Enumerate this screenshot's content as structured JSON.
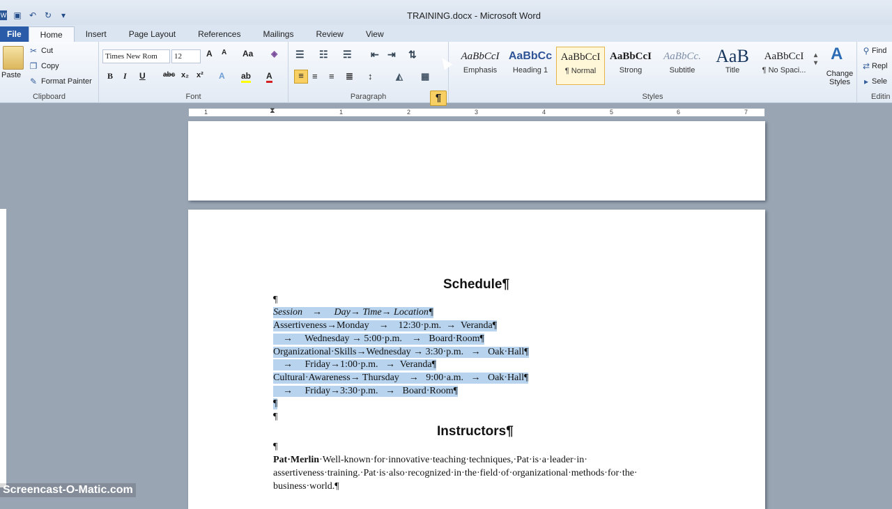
{
  "window": {
    "title": "TRAINING.docx - Microsoft Word",
    "app_icon": "word-icon"
  },
  "tabs": [
    "File",
    "Home",
    "Insert",
    "Page Layout",
    "References",
    "Mailings",
    "Review",
    "View"
  ],
  "clipboard": {
    "group": "Clipboard",
    "paste": "Paste",
    "cut": "Cut",
    "copy": "Copy",
    "painter": "Format Painter"
  },
  "font": {
    "group": "Font",
    "name": "Times New Rom",
    "size": "12"
  },
  "paragraph": {
    "group": "Paragraph",
    "show_marks": "¶"
  },
  "styles": {
    "group": "Styles",
    "items": [
      {
        "preview": "AaBbCcI",
        "name": "Emphasis"
      },
      {
        "preview": "AaBbCc",
        "name": "Heading 1"
      },
      {
        "preview": "AaBbCcI",
        "name": "¶ Normal"
      },
      {
        "preview": "AaBbCcI",
        "name": "Strong"
      },
      {
        "preview": "AaBbCc.",
        "name": "Subtitle"
      },
      {
        "preview": "AaB",
        "name": "Title"
      },
      {
        "preview": "AaBbCcI",
        "name": "¶ No Spaci..."
      }
    ],
    "change": "Change Styles"
  },
  "editing": {
    "group": "Editin",
    "find": "Find",
    "replace": "Repl",
    "select": "Sele"
  },
  "ruler": {
    "marks": [
      "1",
      "1",
      "2",
      "3",
      "4",
      "5",
      "6",
      "7"
    ]
  },
  "document": {
    "heading1": "Schedule¶",
    "blank1": "¶",
    "lines": [
      "Session    →     Day→ Time→ Location¶",
      "Assertiveness→Monday    →    12:30·p.m.  →  Veranda¶",
      "    →     Wednesday → 5:00·p.m.    →   Board·Room¶",
      "Organizational·Skills→Wednesday → 3:30·p.m.   →   Oak·Hall¶",
      "    →     Friday→1:00·p.m.   →  Veranda¶",
      "Cultural·Awareness→ Thursday    →   9:00·a.m.   →   Oak·Hall¶",
      "    →     Friday→3:30·p.m.   →   Board·Room¶",
      "¶"
    ],
    "blank2": "¶",
    "heading2": "Instructors¶",
    "blank3": "¶",
    "para_name": "Pat·Merlin",
    "para_1": "·Well-known·for·innovative·teaching·techniques,·Pat·is·a·leader·in·",
    "para_2": "assertiveness·training.·Pat·is·also·recognized·in·the·field·of·organizational·methods·for·the·",
    "para_3": "business·world.¶"
  },
  "watermark": "Screencast-O-Matic.com"
}
